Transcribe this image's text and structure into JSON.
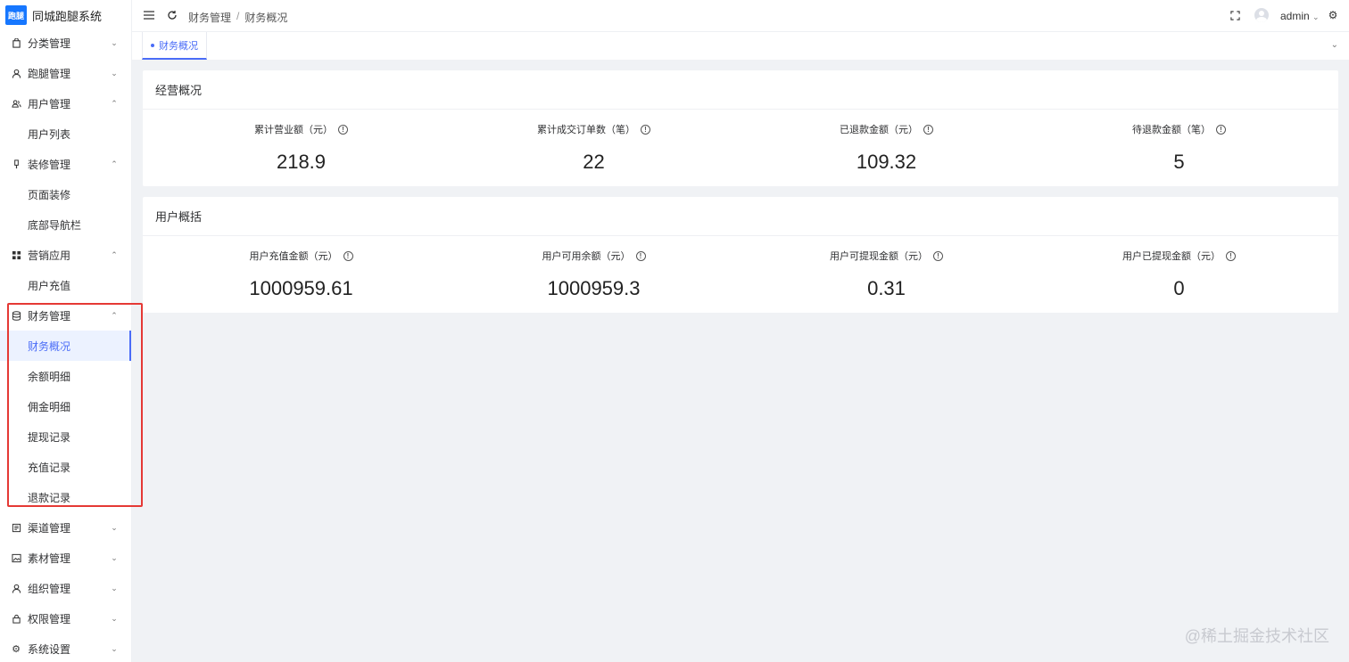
{
  "app": {
    "logo_mark": "跑腿",
    "title": "同城跑腿系统"
  },
  "sidebar": {
    "menus": [
      {
        "label": "分类管理",
        "icon": "bag-icon",
        "expanded": false
      },
      {
        "label": "跑腿管理",
        "icon": "user-icon",
        "expanded": false
      },
      {
        "label": "用户管理",
        "icon": "users-icon",
        "expanded": true,
        "children": [
          "用户列表"
        ]
      },
      {
        "label": "装修管理",
        "icon": "brush-icon",
        "expanded": true,
        "children": [
          "页面装修",
          "底部导航栏"
        ]
      },
      {
        "label": "营销应用",
        "icon": "grid-icon",
        "expanded": true,
        "children": [
          "用户充值"
        ]
      },
      {
        "label": "财务管理",
        "icon": "database-icon",
        "expanded": true,
        "children": [
          "财务概况",
          "余额明细",
          "佣金明细",
          "提现记录",
          "充值记录",
          "退款记录"
        ]
      },
      {
        "label": "渠道管理",
        "icon": "channel-icon",
        "expanded": false
      },
      {
        "label": "素材管理",
        "icon": "image-icon",
        "expanded": false
      },
      {
        "label": "组织管理",
        "icon": "org-icon",
        "expanded": false
      },
      {
        "label": "权限管理",
        "icon": "lock-icon",
        "expanded": false
      },
      {
        "label": "系统设置",
        "icon": "gear-icon",
        "expanded": false
      }
    ],
    "active_item": "财务概况"
  },
  "header": {
    "breadcrumb": [
      "财务管理",
      "财务概况"
    ],
    "user": "admin"
  },
  "tabs": [
    {
      "label": "财务概况",
      "active": true
    }
  ],
  "business_overview": {
    "title": "经营概况",
    "stats": [
      {
        "label": "累计营业额（元）",
        "value": "218.9"
      },
      {
        "label": "累计成交订单数（笔）",
        "value": "22"
      },
      {
        "label": "已退款金额（元）",
        "value": "109.32"
      },
      {
        "label": "待退款金额（笔）",
        "value": "5"
      }
    ]
  },
  "user_overview": {
    "title": "用户概括",
    "stats": [
      {
        "label": "用户充值金额（元）",
        "value": "1000959.61"
      },
      {
        "label": "用户可用余额（元）",
        "value": "1000959.3"
      },
      {
        "label": "用户可提现金额（元）",
        "value": "0.31"
      },
      {
        "label": "用户已提现金额（元）",
        "value": "0"
      }
    ]
  },
  "watermark": "@稀土掘金技术社区",
  "colors": {
    "accent": "#4a6cf7",
    "logo": "#1677ff",
    "highlight": "#e53935"
  }
}
